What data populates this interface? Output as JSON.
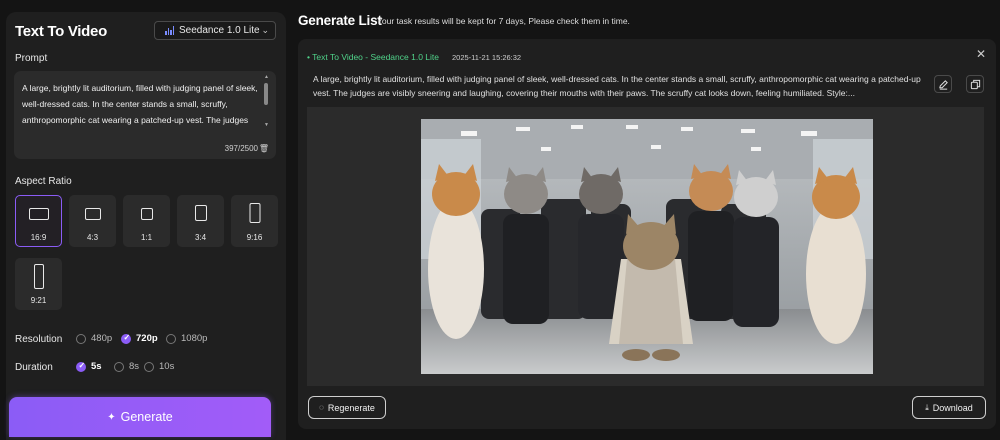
{
  "left": {
    "title": "Text To Video",
    "model": "Seedance 1.0 Lite",
    "prompt_label": "Prompt",
    "prompt_text": "A large, brightly lit auditorium, filled with judging panel of sleek, well-dressed cats. In the center stands a small, scruffy, anthropomorphic cat wearing a patched-up vest. The judges are visibly sneering and laughing, covering their mouths with their paws.",
    "char_count": "397/2500",
    "aspect_label": "Aspect Ratio",
    "aspect_ratios": [
      "16:9",
      "4:3",
      "1:1",
      "3:4",
      "9:16",
      "9:21"
    ],
    "selected_aspect": "16:9",
    "resolution_label": "Resolution",
    "resolutions": [
      "480p",
      "720p",
      "1080p"
    ],
    "selected_resolution": "720p",
    "duration_label": "Duration",
    "durations": [
      "5s",
      "8s",
      "10s"
    ],
    "selected_duration": "5s",
    "generate_label": "Generate"
  },
  "right": {
    "title": "Generate List",
    "subtitle": "Your task results will be kept for 7 days, Please check them in time.",
    "task": {
      "title": "• Text To Video - Seedance 1.0 Lite",
      "timestamp": "2025-11-21 15:26:32",
      "description": "A large, brightly lit auditorium, filled with judging panel of sleek, well-dressed cats. In the center stands a small, scruffy, anthropomorphic cat wearing a patched-up vest. The judges are visibly sneering and laughing, covering their mouths with their paws. The scruffy cat looks down, feeling humiliated. Style:..."
    },
    "regenerate_label": "Regenerate",
    "download_label": "Download"
  },
  "colors": {
    "accent": "#8b5cf6",
    "status_green": "#50d38a",
    "panel": "#1f1f1f",
    "background": "#141414"
  },
  "icons": {
    "model": "bar-chart-icon",
    "chevron": "chevron-down-icon",
    "delete": "trash-icon",
    "generate": "sparkle-icon",
    "close": "close-icon",
    "edit": "edit-icon",
    "copy": "copy-icon",
    "regenerate": "refresh-icon",
    "download": "download-icon"
  }
}
